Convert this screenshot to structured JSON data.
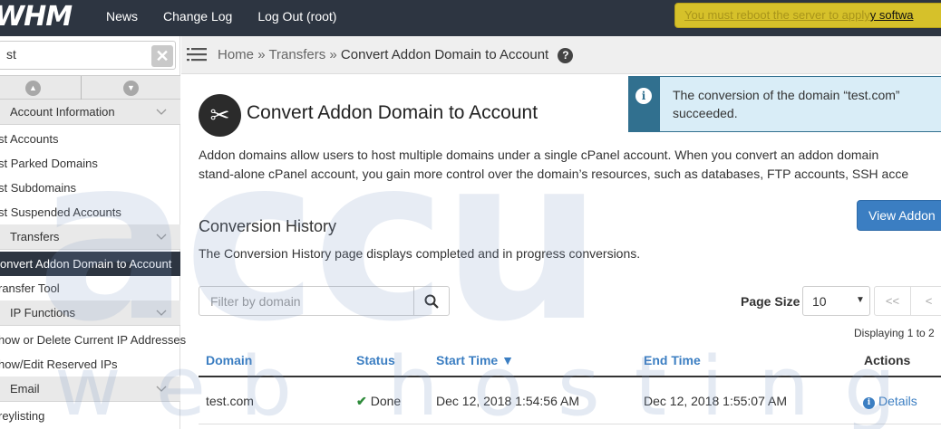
{
  "topbar": {
    "logo": "WHM",
    "nav": [
      "News",
      "Change Log",
      "Log Out (root)"
    ],
    "notice_blurred": "You must reboot the server to apply",
    "notice_tail": "y softwa"
  },
  "sidebar": {
    "search_value": "st",
    "clear_symbol": "✕",
    "categories": {
      "account_information": "Account Information",
      "transfers": "Transfers",
      "ip_functions": "IP Functions",
      "email": "Email"
    },
    "items": {
      "list_accounts": "st Accounts",
      "list_parked": "st Parked Domains",
      "list_subdomains": "st Subdomains",
      "list_suspended": "st Suspended Accounts",
      "convert_addon": "onvert Addon Domain to Account",
      "transfer_tool": "ransfer Tool",
      "show_delete_ip": "how or Delete Current IP Addresses",
      "show_edit_reserved": "how/Edit Reserved IPs",
      "greylisting": "reylisting"
    }
  },
  "breadcrumb": {
    "home": "Home",
    "sep": "»",
    "transfers": "Transfers",
    "current": "Convert Addon Domain to Account",
    "help": "?"
  },
  "page": {
    "title": "Convert Addon Domain to Account",
    "alert_line1": "The conversion of the domain “test.com”",
    "alert_line2": "succeeded.",
    "alert_icon": "i",
    "intro_line1": "Addon domains allow users to host multiple domains under a single cPanel account. When you convert an addon domain",
    "intro_line2": "stand-alone cPanel account, you gain more control over the domain’s resources, such as databases, FTP accounts, SSH acce",
    "view_button": "View Addon",
    "section_title": "Conversion History",
    "section_desc": "The Conversion History page displays completed and in progress conversions.",
    "filter_placeholder": "Filter by domain",
    "page_size_label": "Page Size",
    "page_size_value": "10",
    "pager_first": "<<",
    "pager_prev": "<",
    "displaying": "Displaying 1 to 2"
  },
  "table": {
    "headers": {
      "domain": "Domain",
      "status": "Status",
      "start_time": "Start Time ▼",
      "end_time": "End Time",
      "actions": "Actions"
    },
    "rows": [
      {
        "domain": "test.com",
        "status": "Done",
        "start_time": "Dec 12, 2018 1:54:56 AM",
        "end_time": "Dec 12, 2018 1:55:07 AM",
        "action": "Details"
      }
    ]
  },
  "watermark": {
    "big": "accu",
    "small": "web hosting"
  },
  "colors": {
    "topbar": "#2d3541",
    "accent": "#3b7ec2",
    "alert_bg": "#d9edf7",
    "alert_border": "#31708f",
    "success": "#2e8b3a",
    "notice": "#d6c12a"
  }
}
